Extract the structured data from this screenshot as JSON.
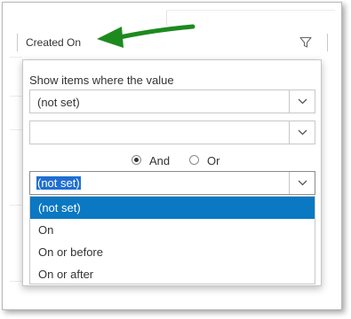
{
  "column": {
    "title": "Created On"
  },
  "filter": {
    "prompt": "Show items where the value",
    "first_operator": "(not set)",
    "first_value": "",
    "logic": {
      "and_label": "And",
      "or_label": "Or",
      "selected": "And"
    },
    "second_operator": "(not set)",
    "options": [
      "(not set)",
      "On",
      "On or before",
      "On or after"
    ],
    "highlighted_option": "(not set)"
  },
  "colors": {
    "arrow": "#1e8a1e",
    "highlight": "#0a78c3",
    "text_selection": "#1f6fd1"
  },
  "icons": {
    "filter": "filter-funnel-icon",
    "chevron": "chevron-down-icon",
    "annotation": "green-arrow-icon"
  }
}
